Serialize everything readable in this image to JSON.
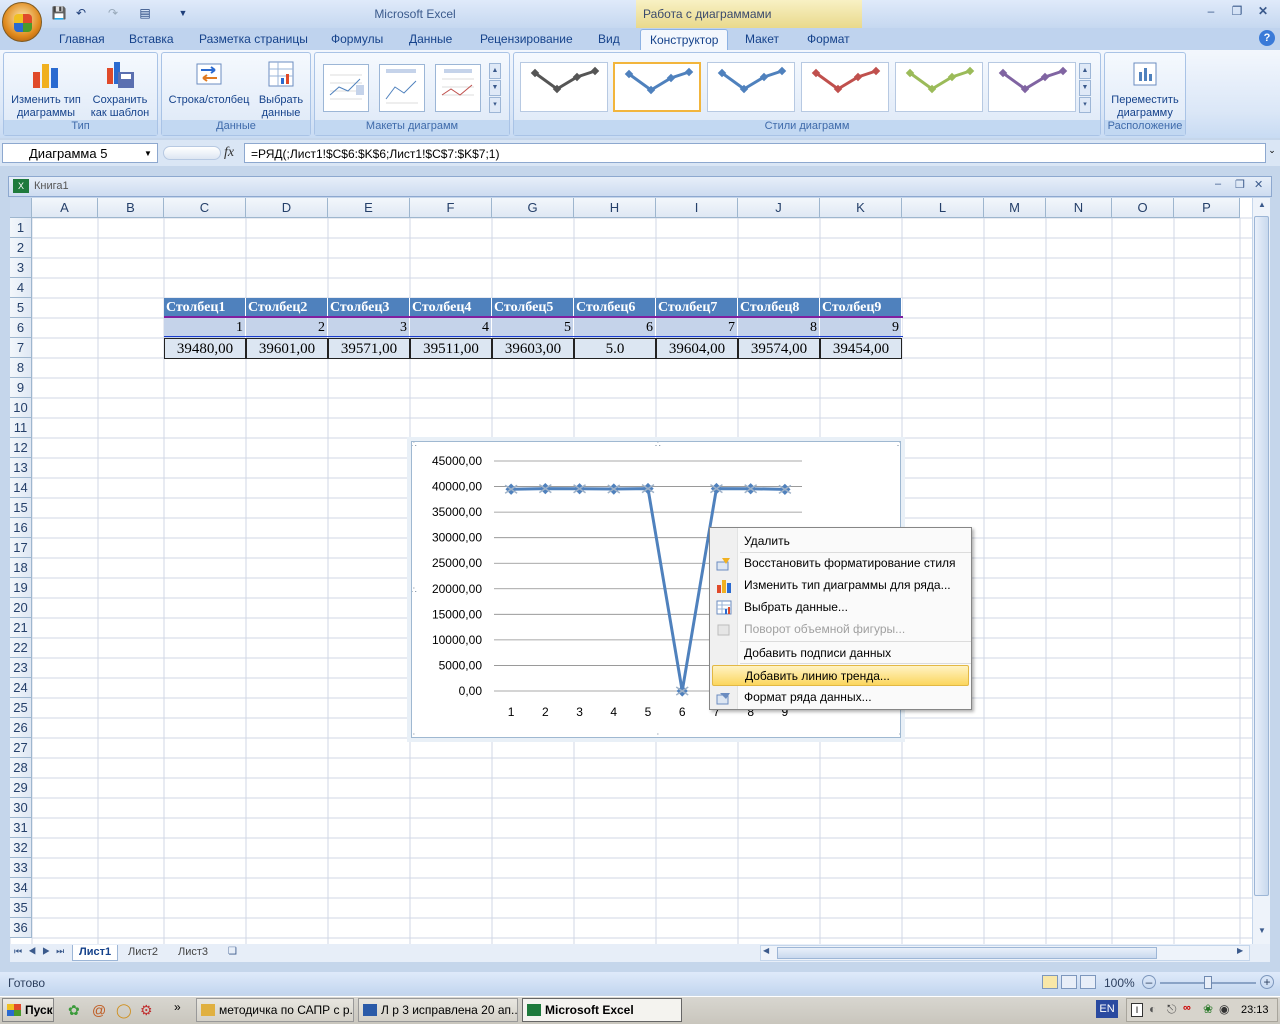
{
  "app": {
    "title": "Microsoft Excel",
    "context_group": "Работа с диаграммами"
  },
  "tabs": [
    "Главная",
    "Вставка",
    "Разметка страницы",
    "Формулы",
    "Данные",
    "Рецензирование",
    "Вид",
    "Конструктор",
    "Макет",
    "Формат"
  ],
  "active_tab": "Конструктор",
  "ribbon": {
    "group_type": {
      "label": "Тип",
      "change_type": "Изменить тип\nдиаграммы",
      "save_template": "Сохранить\nкак шаблон"
    },
    "group_data": {
      "label": "Данные",
      "row_col": "Строка/столбец",
      "select_data": "Выбрать\nданные"
    },
    "group_layouts": {
      "label": "Макеты диаграмм"
    },
    "group_styles": {
      "label": "Стили диаграмм",
      "style_colors": [
        "#555555",
        "#4f81bd",
        "#4f81bd",
        "#c0504d",
        "#9bbb59",
        "#8064a2"
      ],
      "selected_index": 1
    },
    "group_location": {
      "label": "Расположение",
      "move_chart": "Переместить\nдиаграмму"
    }
  },
  "formula_bar": {
    "name_box": "Диаграмма 5",
    "fx": "fx",
    "formula": "=РЯД(;Лист1!$C$6:$K$6;Лист1!$C$7:$K$7;1)"
  },
  "workbook": {
    "title": "Книга1"
  },
  "columns": [
    "A",
    "B",
    "C",
    "D",
    "E",
    "F",
    "G",
    "H",
    "I",
    "J",
    "K",
    "L",
    "M",
    "N",
    "O",
    "P"
  ],
  "rows": [
    "1",
    "2",
    "3",
    "4",
    "5",
    "6",
    "7",
    "8",
    "9",
    "10",
    "11",
    "12",
    "13",
    "14",
    "15",
    "16",
    "17",
    "18",
    "19",
    "20",
    "21",
    "22",
    "23",
    "24",
    "25",
    "26",
    "27",
    "28",
    "29",
    "30",
    "31",
    "32",
    "33",
    "34",
    "35",
    "36"
  ],
  "table": {
    "headers": [
      "Столбец1",
      "Столбец2",
      "Столбец3",
      "Столбец4",
      "Столбец5",
      "Столбец6",
      "Столбец7",
      "Столбец8",
      "Столбец9"
    ],
    "row6": [
      "1",
      "2",
      "3",
      "4",
      "5",
      "6",
      "7",
      "8",
      "9"
    ],
    "row7": [
      "39480,00",
      "39601,00",
      "39571,00",
      "39511,00",
      "39603,00",
      "5.0",
      "39604,00",
      "39574,00",
      "39454,00"
    ]
  },
  "chart_data": {
    "type": "line",
    "categories": [
      "1",
      "2",
      "3",
      "4",
      "5",
      "6",
      "7",
      "8",
      "9"
    ],
    "series": [
      {
        "values": [
          39480,
          39601,
          39571,
          39511,
          39603,
          0,
          39604,
          39574,
          39454
        ],
        "color": "#4f81bd"
      }
    ],
    "ylim": [
      0,
      45000
    ],
    "yticks": [
      "45000,00",
      "40000,00",
      "35000,00",
      "30000,00",
      "25000,00",
      "20000,00",
      "15000,00",
      "10000,00",
      "5000,00",
      "0,00"
    ],
    "grid": true
  },
  "context_menu": [
    {
      "label": "Удалить",
      "enabled": true,
      "icon": ""
    },
    {
      "label": "Восстановить форматирование стиля",
      "enabled": true,
      "icon": "reset-style-icon"
    },
    {
      "label": "Изменить тип диаграммы для ряда...",
      "enabled": true,
      "icon": "chart-type-icon"
    },
    {
      "label": "Выбрать данные...",
      "enabled": true,
      "icon": "select-data-icon"
    },
    {
      "label": "Поворот объемной фигуры...",
      "enabled": false,
      "icon": "rotate-3d-icon"
    },
    {
      "label": "Добавить подписи данных",
      "enabled": true,
      "icon": ""
    },
    {
      "label": "Добавить линию тренда...",
      "enabled": true,
      "highlighted": true,
      "icon": ""
    },
    {
      "label": "Формат ряда данных...",
      "enabled": true,
      "icon": "format-series-icon"
    }
  ],
  "sheets": [
    "Лист1",
    "Лист2",
    "Лист3"
  ],
  "status": {
    "ready": "Готово",
    "zoom": "100%"
  },
  "taskbar": {
    "start": "Пуск",
    "buttons": [
      "методичка по САПР с р...",
      "Л р 3 исправлена 20 ап...",
      "Microsoft Excel"
    ],
    "lang": "EN",
    "time": "23:13"
  }
}
